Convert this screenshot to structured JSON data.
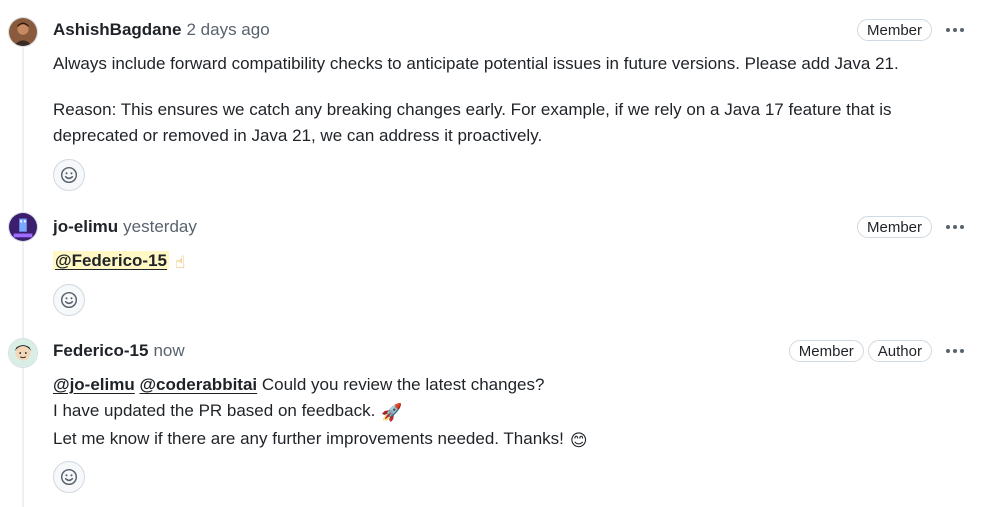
{
  "comments": [
    {
      "author": "AshishBagdane",
      "time": "2 days ago",
      "badges": [
        "Member"
      ],
      "paragraphs": [
        "Always include forward compatibility checks to anticipate potential issues in future versions. Please add Java 21.",
        "Reason: This ensures we catch any breaking changes early. For example, if we rely on a Java 17 feature that is",
        "deprecated or removed in Java 21, we can address it proactively."
      ]
    },
    {
      "author": "jo-elimu",
      "time": "yesterday",
      "badges": [
        "Member"
      ],
      "mention": "@Federico-15",
      "emoji": "☝"
    },
    {
      "author": "Federico-15",
      "time": "now",
      "badges": [
        "Member",
        "Author"
      ],
      "mentions": [
        "@jo-elimu",
        "@coderabbitai"
      ],
      "line1_text": "Could you review the latest changes?",
      "line2_text": "I have updated the PR based on feedback.",
      "line2_emoji": "🚀",
      "line3_text": "Let me know if there are any further improvements needed. Thanks!",
      "line3_emoji": "😊"
    }
  ],
  "icons": {
    "more": "kebab-horizontal-icon",
    "reaction": "smiley-icon"
  },
  "colors": {
    "text": "#1f2328",
    "muted": "#59636e",
    "border": "#d1d9e0",
    "mention_highlight": "#fff8c5"
  }
}
